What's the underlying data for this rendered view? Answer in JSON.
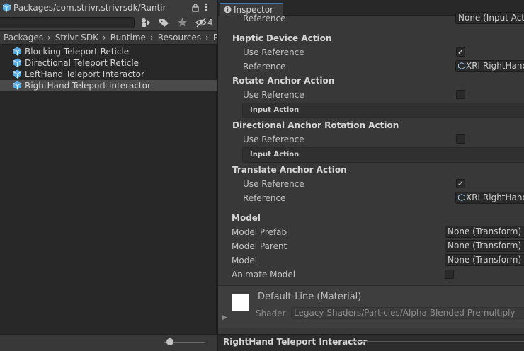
{
  "project": {
    "toolbar": {
      "hidden_count": "4"
    },
    "breadcrumb": [
      "Packages",
      "Strivr SDK",
      "Runtime",
      "Resources",
      "Pr"
    ],
    "assets": [
      {
        "label": "Blocking Teleport Reticle"
      },
      {
        "label": "Directional Teleport Reticle"
      },
      {
        "label": "LeftHand Teleport Interactor"
      },
      {
        "label": "RightHand Teleport Interactor",
        "selected": true
      }
    ],
    "footer_path": "Packages/com.strivr.strivrsdk/Runtime/Res"
  },
  "inspector": {
    "tab_label": "Inspector",
    "top_reference_label": "Reference",
    "top_reference_value": "None (Input Actio",
    "haptic": {
      "header": "Haptic Device Action",
      "use_ref_label": "Use Reference",
      "use_ref_checked": true,
      "ref_label": "Reference",
      "ref_value": "XRI RightHand"
    },
    "rotate": {
      "header": "Rotate Anchor Action",
      "use_ref_label": "Use Reference",
      "use_ref_checked": false,
      "input_action": "Input Action"
    },
    "directional": {
      "header": "Directional Anchor Rotation Action",
      "use_ref_label": "Use Reference",
      "use_ref_checked": false,
      "input_action": "Input Action"
    },
    "translate": {
      "header": "Translate Anchor Action",
      "use_ref_label": "Use Reference",
      "use_ref_checked": true,
      "ref_label": "Reference",
      "ref_value": "XRI RightHand"
    },
    "model": {
      "header": "Model",
      "prefab_label": "Model Prefab",
      "prefab_value": "None (Transform)",
      "parent_label": "Model Parent",
      "parent_value": "None (Transform)",
      "model_label": "Model",
      "model_value": "None (Transform)",
      "animate_label": "Animate Model",
      "animate_checked": false
    },
    "material": {
      "name": "Default-Line (Material)",
      "shader_label": "Shader",
      "shader_value": "Legacy Shaders/Particles/Alpha Blended Premultiply"
    },
    "preview_title": "RightHand Teleport Interactor"
  }
}
